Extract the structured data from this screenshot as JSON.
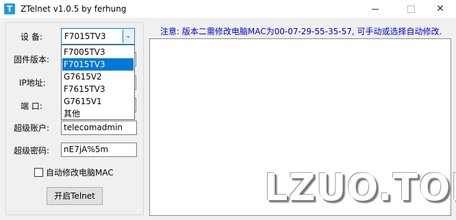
{
  "window": {
    "title": "ZTelnet v1.0.5 by ferhung",
    "icon_letter": "T",
    "icon_color": "#1e9be0",
    "close_glyph": "✕"
  },
  "form": {
    "device_label": "设 备:",
    "firmware_label": "固件版本:",
    "ip_label": "IP地址:",
    "port_label": "端 口:",
    "super_account_label": "超级账户:",
    "super_account_value": "telecomadmin",
    "super_password_label": "超级密码:",
    "super_password_value": "nE7jA%5m",
    "auto_mac_label": "自动修改电脑MAC",
    "auto_mac_checked": false,
    "open_telnet_button": "开启Telnet"
  },
  "device_select": {
    "value": "F7015TV3",
    "options": [
      "F7005TV3",
      "F7015TV3",
      "G7615V2",
      "F7615TV3",
      "G7615V1",
      "其他"
    ],
    "selected_index": 1,
    "accent_color": "#0078d7"
  },
  "notice": "注意: 版本二需修改电脑MAC为00-07-29-55-35-57, 可手动或选择自动修改.",
  "watermark": "LZUO.TOP"
}
